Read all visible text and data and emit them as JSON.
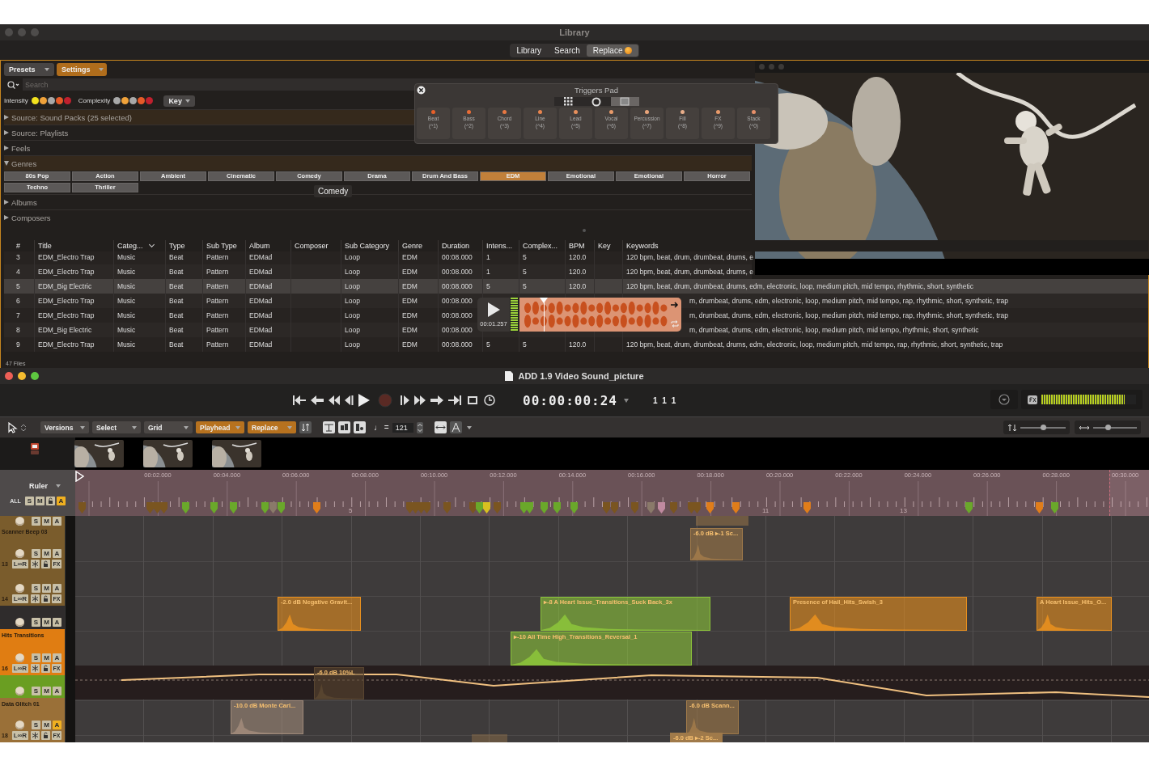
{
  "library_window": {
    "title": "Library",
    "tabs": [
      {
        "label": "Library",
        "selected": false
      },
      {
        "label": "Search",
        "selected": false
      },
      {
        "label": "Replace",
        "selected": true
      }
    ],
    "toolbar": [
      {
        "label": "Presets",
        "on": false
      },
      {
        "label": "Settings",
        "on": true
      }
    ],
    "search": {
      "placeholder": "Search"
    },
    "intensity": {
      "label": "Intensity",
      "dots": [
        {
          "color": "#f2e21e"
        },
        {
          "color": "#f0a23a"
        },
        {
          "color": "#a8a8a8"
        },
        {
          "color": "#e65a28"
        },
        {
          "color": "#c0202e"
        }
      ]
    },
    "complexity": {
      "label": "Complexity",
      "dots": [
        {
          "color": "#a8a8a8"
        },
        {
          "color": "#f0a23a"
        },
        {
          "color": "#a8a8a8"
        },
        {
          "color": "#e65a28"
        },
        {
          "color": "#c0202e"
        }
      ]
    },
    "key_button": "Key",
    "sections": [
      {
        "label": "Source: Sound Packs (25 selected)",
        "expanded": false,
        "selected": true
      },
      {
        "label": "Source: Playlists",
        "expanded": false,
        "selected": false
      },
      {
        "label": "Feels",
        "expanded": false,
        "selected": false
      },
      {
        "label": "Genres",
        "expanded": true,
        "selected": true,
        "genres": [
          {
            "label": "80s Pop",
            "selected": false
          },
          {
            "label": "Action",
            "selected": false
          },
          {
            "label": "Ambient",
            "selected": false
          },
          {
            "label": "Cinematic",
            "selected": false
          },
          {
            "label": "Comedy",
            "selected": false
          },
          {
            "label": "Drama",
            "selected": false
          },
          {
            "label": "Drum And Bass",
            "selected": false
          },
          {
            "label": "EDM",
            "selected": true
          },
          {
            "label": "Emotional",
            "selected": false
          },
          {
            "label": "Emotional",
            "selected": false
          },
          {
            "label": "Horror",
            "selected": false
          },
          {
            "label": "Techno",
            "selected": false
          },
          {
            "label": "Thriller",
            "selected": false
          }
        ]
      },
      {
        "label": "Albums",
        "expanded": false,
        "selected": false
      },
      {
        "label": "Composers",
        "expanded": false,
        "selected": false
      }
    ],
    "tooltip": "Comedy",
    "table": {
      "columns": [
        "#",
        "Title",
        "Categ...",
        "Type",
        "Sub Type",
        "Album",
        "Composer",
        "Sub Category",
        "Genre",
        "Duration",
        "Intens...",
        "Complex...",
        "BPM",
        "Key",
        "Keywords"
      ],
      "rows": [
        {
          "num": "3",
          "title": "EDM_Electro Trap",
          "category": "Music",
          "type": "Beat",
          "sub_type": "Pattern",
          "album": "EDMad",
          "sub_category": "Loop",
          "genre": "EDM",
          "duration": "00:08.000",
          "intensity": "1",
          "complexity": "5",
          "bpm": "120.0",
          "keywords": "120 bpm, beat, drum, drumbeat, drums, e",
          "selected": false
        },
        {
          "num": "4",
          "title": "EDM_Electro Trap",
          "category": "Music",
          "type": "Beat",
          "sub_type": "Pattern",
          "album": "EDMad",
          "sub_category": "Loop",
          "genre": "EDM",
          "duration": "00:08.000",
          "intensity": "1",
          "complexity": "5",
          "bpm": "120.0",
          "keywords": "120 bpm, beat, drum, drumbeat, drums, e",
          "selected": false
        },
        {
          "num": "5",
          "title": "EDM_Big Electric",
          "category": "Music",
          "type": "Beat",
          "sub_type": "Pattern",
          "album": "EDMad",
          "sub_category": "Loop",
          "genre": "EDM",
          "duration": "00:08.000",
          "intensity": "5",
          "complexity": "5",
          "bpm": "120.0",
          "keywords": "120 bpm, beat, drum, drumbeat, drums, edm, electronic, loop, medium pitch, mid tempo, rhythmic, short, synthetic",
          "selected": true
        },
        {
          "num": "6",
          "title": "EDM_Electro Trap",
          "category": "Music",
          "type": "Beat",
          "sub_type": "Pattern",
          "album": "EDMad",
          "sub_category": "Loop",
          "genre": "EDM",
          "duration": "00:08.000",
          "keywords": "m, drumbeat, drums, edm, electronic, loop, medium pitch, mid tempo, rap, rhythmic, short, synthetic, trap",
          "selected": false
        },
        {
          "num": "7",
          "title": "EDM_Electro Trap",
          "category": "Music",
          "type": "Beat",
          "sub_type": "Pattern",
          "album": "EDMad",
          "sub_category": "Loop",
          "genre": "EDM",
          "duration": "00:08.000",
          "keywords": "m, drumbeat, drums, edm, electronic, loop, medium pitch, mid tempo, rap, rhythmic, short, synthetic, trap",
          "selected": false
        },
        {
          "num": "8",
          "title": "EDM_Big Electric",
          "category": "Music",
          "type": "Beat",
          "sub_type": "Pattern",
          "album": "EDMad",
          "sub_category": "Loop",
          "genre": "EDM",
          "duration": "00:08.000",
          "keywords": "m, drumbeat, drums, edm, electronic, loop, medium pitch, mid tempo, rhythmic, short, synthetic",
          "selected": false
        },
        {
          "num": "9",
          "title": "EDM_Electro Trap",
          "category": "Music",
          "type": "Beat",
          "sub_type": "Pattern",
          "album": "EDMad",
          "sub_category": "Loop",
          "genre": "EDM",
          "duration": "00:08.000",
          "intensity": "5",
          "complexity": "5",
          "bpm": "120.0",
          "keywords": "120 bpm, beat, drum, drumbeat, drums, edm, electronic, loop, medium pitch, mid tempo, rap, rhythmic, short, synthetic, trap",
          "selected": false
        }
      ]
    },
    "footer": "47 Files"
  },
  "triggers_pad": {
    "title": "Triggers Pad",
    "views": [
      {
        "kind": "grid",
        "selected": false
      },
      {
        "kind": "ring",
        "selected": false
      },
      {
        "kind": "card",
        "selected": true
      }
    ],
    "pads": [
      {
        "name": "Beat",
        "key": "(^1)",
        "color": "#e8602a"
      },
      {
        "name": "Bass",
        "key": "(^2)",
        "color": "#e86c36"
      },
      {
        "name": "Chord",
        "key": "(^3)",
        "color": "#e87842"
      },
      {
        "name": "Line",
        "key": "(^4)",
        "color": "#e8844e"
      },
      {
        "name": "Lead",
        "key": "(^5)",
        "color": "#e8905c"
      },
      {
        "name": "Vocal",
        "key": "(^6)",
        "color": "#e89a6a"
      },
      {
        "name": "Percussion",
        "key": "(^7)",
        "color": "#e8a47a"
      },
      {
        "name": "Fill",
        "key": "(^8)",
        "color": "#e8ae8a"
      },
      {
        "name": "FX",
        "key": "(^9)",
        "color": "#e89a6a"
      },
      {
        "name": "Stack",
        "key": "(^0)",
        "color": "#e8906a"
      }
    ]
  },
  "preview_player": {
    "time": "00:01.257",
    "level": 0.15
  },
  "session_window": {
    "title": "ADD 1.9 Video Sound_picture",
    "timecode": "00:00:00:24",
    "position": "1 1 1",
    "meter": {
      "level": 0.88
    },
    "toolbar": [
      {
        "label": "Versions",
        "on": false
      },
      {
        "label": "Select",
        "on": false
      },
      {
        "label": "Grid",
        "on": false
      },
      {
        "label": "Playhead",
        "on": true
      },
      {
        "label": "Replace",
        "on": true
      }
    ],
    "tempo_label": "♩ =",
    "tempo": "121",
    "zoom_sliders": [
      {
        "level": 0.5
      },
      {
        "level": 0.35
      }
    ],
    "ruler": {
      "label": "Ruler",
      "all": "ALL",
      "solo": "S",
      "mute": "M",
      "auto": "A",
      "auto_on": true,
      "times": [
        "00:02.000",
        "00:04.000",
        "00:06.000",
        "00:08.000",
        "00:10.000",
        "00:12.000",
        "00:14.000",
        "00:16.000",
        "00:18.000",
        "00:20.000",
        "00:22.000",
        "00:24.000",
        "00:26.000",
        "00:28.000",
        "00:30.000"
      ],
      "bars": [
        "5",
        "11",
        "13"
      ]
    },
    "tracks": [
      {
        "color": "#7a5c2c",
        "solo": "S",
        "mute": "M",
        "auto": "A",
        "auto_on": false
      },
      {
        "name": "Scanner Beep 03",
        "number": "13",
        "color": "#7a5c2c",
        "solo": "S",
        "mute": "M",
        "auto": "A",
        "auto_on": false,
        "loop": "L∞R",
        "fx": "FX"
      },
      {
        "number": "14",
        "color": "#7a5c2c",
        "solo": "S",
        "mute": "M",
        "auto": "A",
        "auto_on": false,
        "loop": "L∞R",
        "fx": "FX"
      },
      {
        "color": "#2f2c2c",
        "solo": "S",
        "mute": "M",
        "auto": "A",
        "auto_on": false
      },
      {
        "name": "Hits Transitions",
        "number": "16",
        "color": "#e07d12",
        "solo": "S",
        "mute": "M",
        "auto": "A",
        "auto_on": false,
        "loop": "L∞R",
        "fx": "FX"
      },
      {
        "color": "#6a9e22",
        "solo": "S",
        "mute": "M",
        "auto": "A",
        "auto_on": false
      },
      {
        "name": "Data Glitch 01",
        "number": "18",
        "color": "#9a7038",
        "solo": "S",
        "mute": "M",
        "auto": "A",
        "auto_on": true,
        "loop": "L∞R",
        "fx": "FX"
      }
    ],
    "clips": [
      {
        "label": "-6.0 dB ▸-1 Sc...",
        "color": "#a07a4a"
      },
      {
        "label": "-2.0 dB Negative Gravit...",
        "color": "#e8901e"
      },
      {
        "label": "▸-8 A Heart Issue_Transitions_Suck Back_3x",
        "color": "#8cc43a"
      },
      {
        "label": "Presence of Hail_Hits_Swish_3",
        "color": "#e8901e"
      },
      {
        "label": "A Heart Issue_Hits_O...",
        "color": "#e8901e"
      },
      {
        "label": "▸-10 All Time High_Transitions_Reversal_1",
        "color": "#8cc43a"
      },
      {
        "label": "-6.0 dB 10%L",
        "color": "#5a4630"
      },
      {
        "label": "-10.0 dB Monte Carl...",
        "color": "#a08a7a"
      },
      {
        "label": "-6.0 dB Scann...",
        "color": "#a07a4a"
      },
      {
        "label": "-6.0 dB ▸-2 Sc...",
        "color": "#a07a4a"
      }
    ]
  }
}
